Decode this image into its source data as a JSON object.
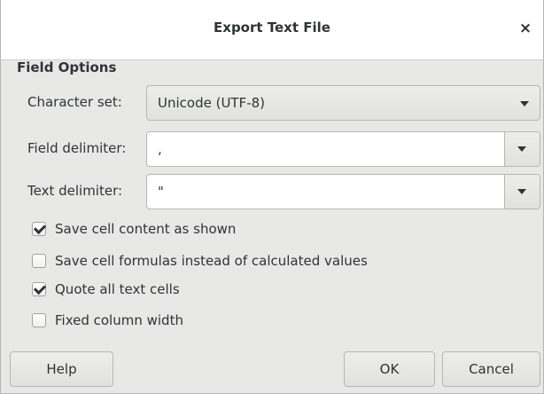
{
  "dialog": {
    "title": "Export Text File",
    "close_glyph": "×"
  },
  "field_options": {
    "section_title": "Field Options",
    "character_set": {
      "label": "Character set:",
      "value": "Unicode (UTF-8)"
    },
    "field_delimiter": {
      "label": "Field delimiter:",
      "value": ","
    },
    "text_delimiter": {
      "label": "Text delimiter:",
      "value": "\""
    }
  },
  "options": [
    {
      "label": "Save cell content as shown",
      "checked": true
    },
    {
      "label": "Save cell formulas instead of calculated values",
      "checked": false
    },
    {
      "label": "Quote all text cells",
      "checked": true
    },
    {
      "label": "Fixed column width",
      "checked": false
    }
  ],
  "buttons": {
    "help": "Help",
    "ok": "OK",
    "cancel": "Cancel"
  },
  "icons": {
    "close": "close-icon",
    "dropdown": "chevron-down-icon",
    "check": "checkmark-icon"
  }
}
